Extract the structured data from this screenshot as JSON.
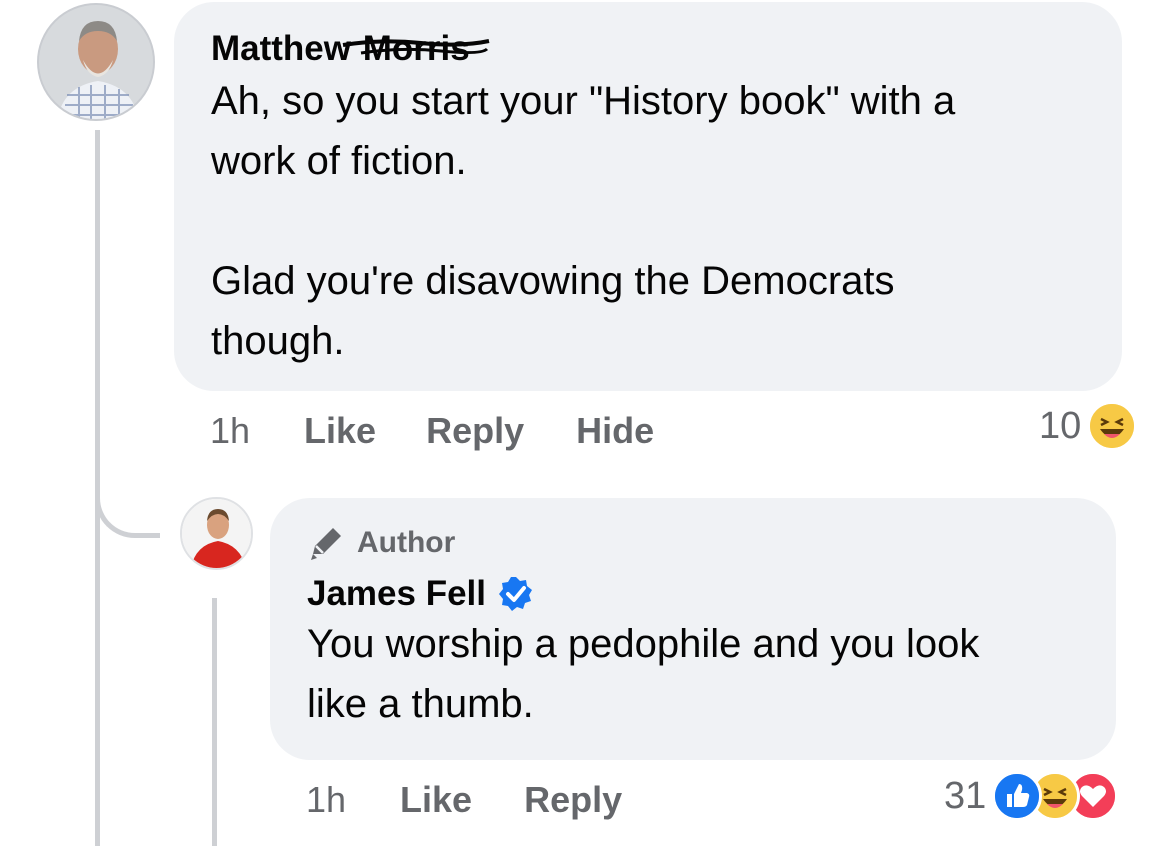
{
  "comment1": {
    "author_first": "Matthew",
    "author_last_redacted": "Morris",
    "text": "Ah, so you start your \"History book\" with a\nwork of fiction.\n\nGlad you're disavowing the Democrats\nthough.",
    "time": "1h",
    "actions": [
      "Like",
      "Reply",
      "Hide"
    ],
    "reaction_count": "10",
    "reaction_icons": [
      "haha-icon"
    ]
  },
  "reply1": {
    "badge_label": "Author",
    "author": "James Fell",
    "verified": true,
    "text": "You worship a pedophile and you look\nlike a thumb.",
    "time": "1h",
    "actions": [
      "Like",
      "Reply"
    ],
    "reaction_count": "31",
    "reaction_icons": [
      "like-icon",
      "haha-icon",
      "love-icon"
    ]
  },
  "colors": {
    "bubble": "#f0f2f5",
    "meta_text": "#65676b",
    "like_blue": "#1877f2",
    "love_red": "#f33e58",
    "haha_yellow": "#f7c945",
    "verified_blue": "#1877f2"
  }
}
